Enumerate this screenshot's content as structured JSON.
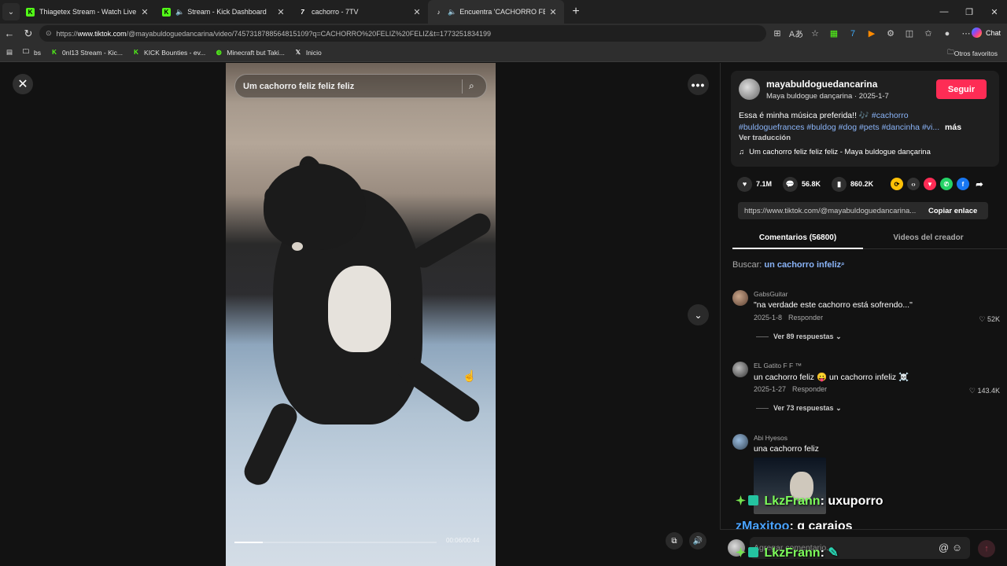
{
  "browser": {
    "tabs": [
      {
        "title": "Thiagetex Stream - Watch Live on",
        "icon": "kick-icon",
        "color": "#53fc18",
        "audio": false,
        "active": false
      },
      {
        "title": "Stream - Kick Dashboard",
        "icon": "kick-icon",
        "color": "#53fc18",
        "audio": true,
        "active": false
      },
      {
        "title": "cachorro - 7TV",
        "icon": "7tv-icon",
        "color": "#ffffff",
        "audio": false,
        "active": false
      },
      {
        "title": "Encuentra 'CACHORRO FELIZ",
        "icon": "tiktok-icon",
        "color": "#ffffff",
        "audio": true,
        "active": true
      }
    ],
    "url_prefix": "https://",
    "url_host": "www.tiktok.com",
    "url_rest": "/@mayabuldoguedancarina/video/7457318788564815109?q=CACHORRO%20FELIZ%20FELIZ&t=1773251834199",
    "copilot_label": "Chat",
    "bookmarks": [
      {
        "label": "bs",
        "icon": "folder-icon"
      },
      {
        "label": "0nl13 Stream - Kic...",
        "icon": "kick-icon"
      },
      {
        "label": "KICK Bounties - ev...",
        "icon": "kick-icon"
      },
      {
        "label": "Minecraft but Taki...",
        "icon": "globe-icon"
      },
      {
        "label": "Inicio",
        "icon": "x-icon"
      }
    ],
    "other_bookmarks": "Otros favoritos"
  },
  "video": {
    "search_query": "Um cachorro feliz feliz feliz",
    "timecode": "00:06/00:44",
    "progress": 0.14
  },
  "author": {
    "username": "mayabuldoguedancarina",
    "subtitle": "Maya buldogue dançarina · 2025-1-7",
    "follow_label": "Seguir",
    "description_start": "Essa é minha música preferida!! 🎶",
    "description_tags_line1": "#cachorro",
    "description_tags_line2": "#buldoguefrances #buldog #dog #pets #dancinha #vi...",
    "more_label": "más",
    "translate_label": "Ver traducción",
    "music": "Um cachorro feliz feliz feliz - Maya buldogue dançarina"
  },
  "stats": {
    "likes": "7.1M",
    "comments": "56.8K",
    "saves": "860.2K"
  },
  "share": {
    "link": "https://www.tiktok.com/@mayabuldoguedancarina...",
    "copy_label": "Copiar enlace"
  },
  "panel_tabs": {
    "comments": "Comentarios (56800)",
    "creator_videos": "Videos del creador"
  },
  "search_hint": {
    "prefix": "Buscar:",
    "keyword": "un cachorro infeliz"
  },
  "comments": [
    {
      "user": "GabsGuitar",
      "text": "\"na verdade este cachorro está sofrendo...\"",
      "date": "2025-1-8",
      "reply": "Responder",
      "likes": "52K",
      "replies": "Ver 89 respuestas"
    },
    {
      "user": "EL Gatito F F ™",
      "text": "un cachorro feliz 😛 un cachorro infeliz ☠️",
      "date": "2025-1-27",
      "reply": "Responder",
      "likes": "143.4K",
      "replies": "Ver 73 respuestas"
    },
    {
      "user": "Abi Hyesos",
      "text": "una cachorro feliz"
    }
  ],
  "overlay_chat": [
    {
      "nick": "LkzFrann",
      "message": ": uxuporro"
    },
    {
      "nick": "zMaxitoo",
      "message": ": q carajos"
    },
    {
      "nick": "LkzFrann",
      "message": ":"
    }
  ],
  "comment_box": {
    "placeholder": "Agregar comentario..."
  }
}
